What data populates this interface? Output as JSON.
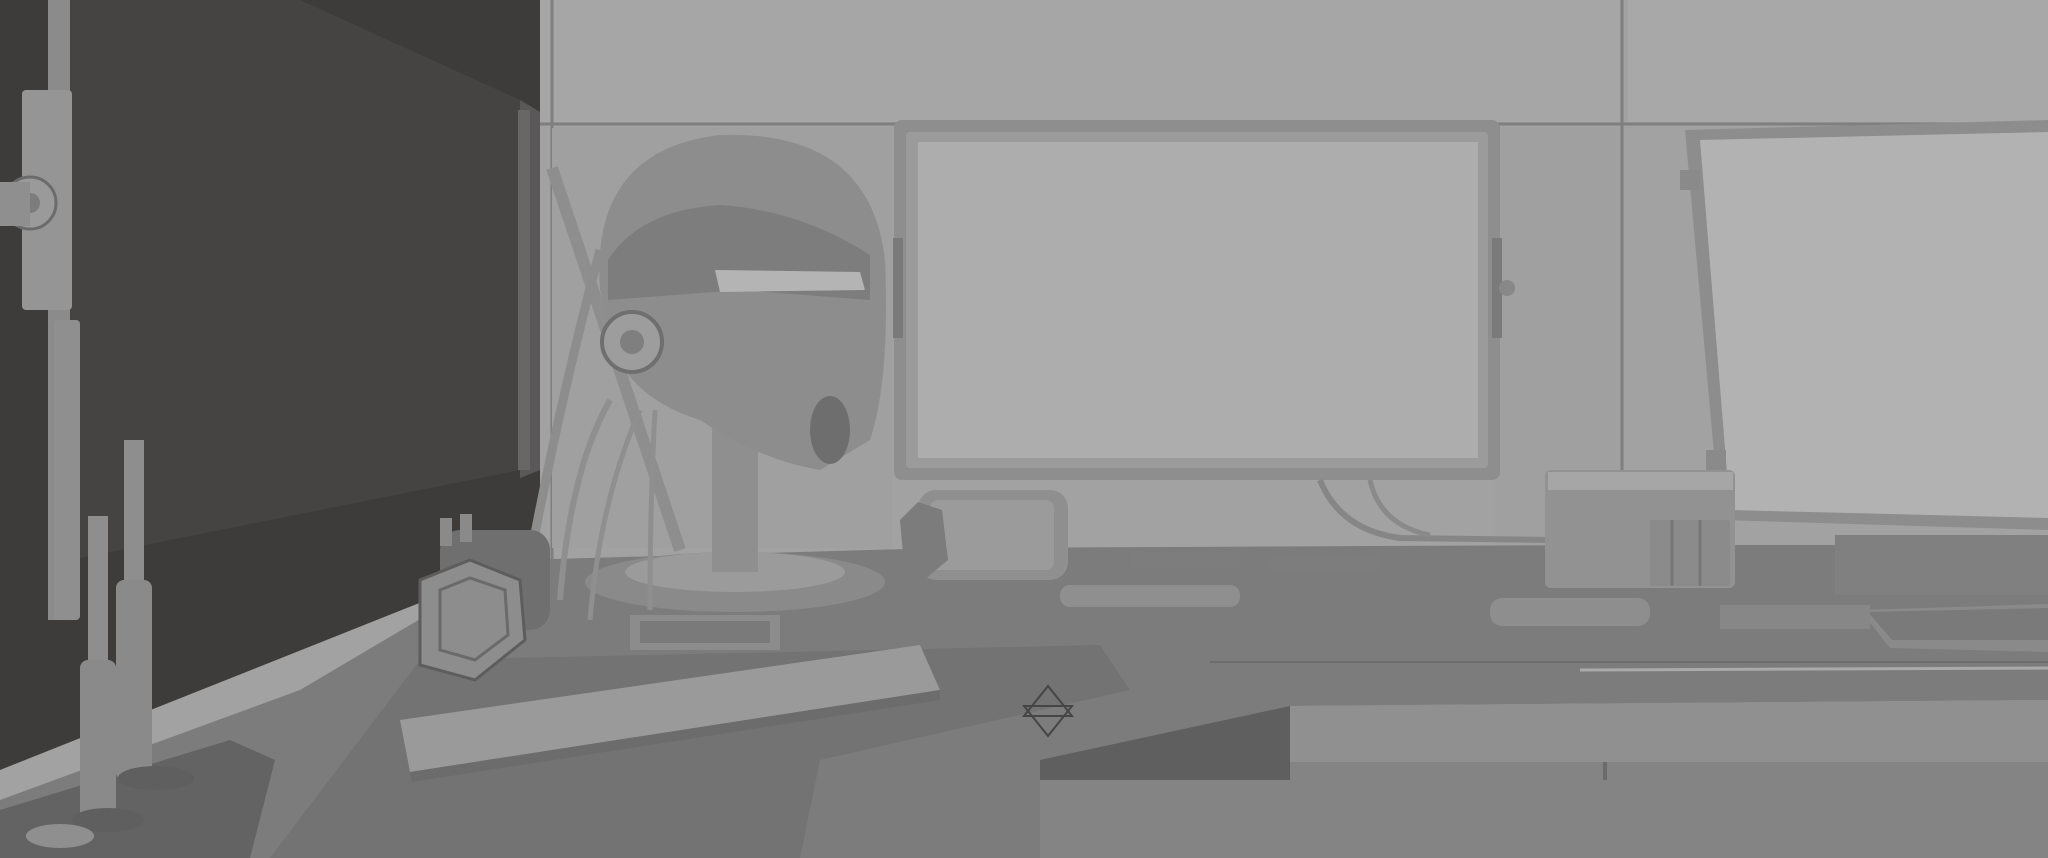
{
  "scene": {
    "palette": {
      "dark_wall": "#3f3d3c",
      "wall": "#a3a3a3",
      "wall_light": "#b1b1b1",
      "panel_line": "#7a7a7a",
      "desk_top": "#7b7b7b",
      "desk_edge": "#5e5e5e",
      "prop": "#8f8f8f",
      "prop_light": "#b4b4b4",
      "prop_dark": "#5a5a5a",
      "screen": "#a9a9a9"
    },
    "objects": [
      "dark-wall-panel",
      "back-wall-panels",
      "center-monitor",
      "right-monitor",
      "helmet-on-stand",
      "antenna-rod",
      "cylinder-canister",
      "hexagon-canister",
      "power-box",
      "keyboard",
      "handheld-tools",
      "welding-torches",
      "circuit-boards",
      "rail-bar",
      "desk-surface",
      "drawer-cabinet"
    ]
  }
}
